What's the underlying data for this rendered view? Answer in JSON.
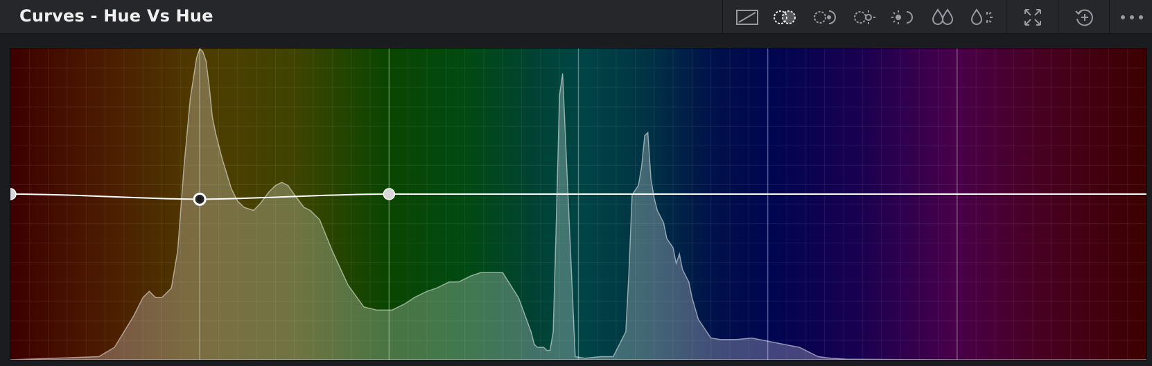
{
  "panel": {
    "title": "Curves - Hue Vs Hue"
  },
  "toolbar": {
    "tools": [
      {
        "name": "custom-curves-icon",
        "active": false
      },
      {
        "name": "hue-vs-hue-icon",
        "active": true
      },
      {
        "name": "hue-vs-sat-icon",
        "active": false
      },
      {
        "name": "hue-vs-lum-icon",
        "active": false
      },
      {
        "name": "lum-vs-sat-icon",
        "active": false
      },
      {
        "name": "sat-vs-sat-icon",
        "active": false
      },
      {
        "name": "sat-vs-lum-icon",
        "active": false
      },
      {
        "name": "expand-icon",
        "active": false
      },
      {
        "name": "reset-icon",
        "active": false
      },
      {
        "name": "more-options-icon",
        "active": false
      }
    ]
  },
  "curve": {
    "type": "hue-vs-hue",
    "control_points": [
      {
        "hue_deg": 0,
        "shift": 0
      },
      {
        "hue_deg": 60,
        "shift": -0.035
      },
      {
        "hue_deg": 120,
        "shift": 0
      }
    ],
    "selected_point_index": 1,
    "guide_hues_deg": [
      60,
      120,
      180,
      240,
      300
    ]
  },
  "colors": {
    "background": "#1b1c1f",
    "header": "#26272b",
    "title_text": "#f0f0f0",
    "icon": "#9a9ba0",
    "icon_active": "#e6e6e6",
    "curve": "#ffffff",
    "grid": "#ffffff",
    "histogram_fill": "#ffffff"
  },
  "histogram": {
    "hue_range_deg": [
      0,
      360
    ],
    "hue_deg": [
      0,
      28,
      33,
      39,
      42,
      44,
      46,
      48,
      51,
      53,
      55,
      57,
      59,
      60,
      61,
      62,
      63,
      64,
      65,
      67,
      70,
      72,
      74,
      77,
      79,
      82,
      84,
      86,
      88,
      90,
      93,
      95,
      98,
      102,
      107,
      112,
      116,
      121,
      125,
      128,
      132,
      135,
      139,
      142,
      146,
      149,
      151,
      153,
      156,
      161,
      165,
      166,
      167,
      169,
      170,
      171,
      172,
      173,
      174,
      175,
      179,
      182,
      187,
      191,
      195,
      196,
      197,
      199,
      200,
      201,
      202,
      203,
      204,
      205,
      207,
      208,
      210,
      211,
      212,
      213,
      215,
      216,
      218,
      222,
      225,
      230,
      235,
      240,
      245,
      250,
      254,
      256,
      260,
      265,
      280,
      300,
      330,
      360
    ],
    "level": [
      0,
      0.01,
      0.04,
      0.14,
      0.2,
      0.22,
      0.2,
      0.2,
      0.23,
      0.35,
      0.62,
      0.84,
      0.97,
      1.0,
      0.99,
      0.96,
      0.88,
      0.78,
      0.73,
      0.65,
      0.55,
      0.51,
      0.49,
      0.48,
      0.5,
      0.54,
      0.56,
      0.57,
      0.56,
      0.53,
      0.49,
      0.48,
      0.45,
      0.35,
      0.24,
      0.17,
      0.16,
      0.16,
      0.18,
      0.2,
      0.22,
      0.23,
      0.25,
      0.25,
      0.27,
      0.28,
      0.28,
      0.28,
      0.28,
      0.2,
      0.09,
      0.05,
      0.04,
      0.04,
      0.03,
      0.03,
      0.09,
      0.45,
      0.85,
      0.92,
      0.01,
      0.005,
      0.01,
      0.01,
      0.09,
      0.28,
      0.53,
      0.56,
      0.62,
      0.72,
      0.73,
      0.58,
      0.52,
      0.48,
      0.44,
      0.39,
      0.36,
      0.31,
      0.34,
      0.29,
      0.25,
      0.2,
      0.13,
      0.07,
      0.065,
      0.065,
      0.07,
      0.06,
      0.05,
      0.04,
      0.02,
      0.01,
      0.005,
      0.002,
      0.001,
      0.0,
      0.0,
      0.0
    ]
  }
}
